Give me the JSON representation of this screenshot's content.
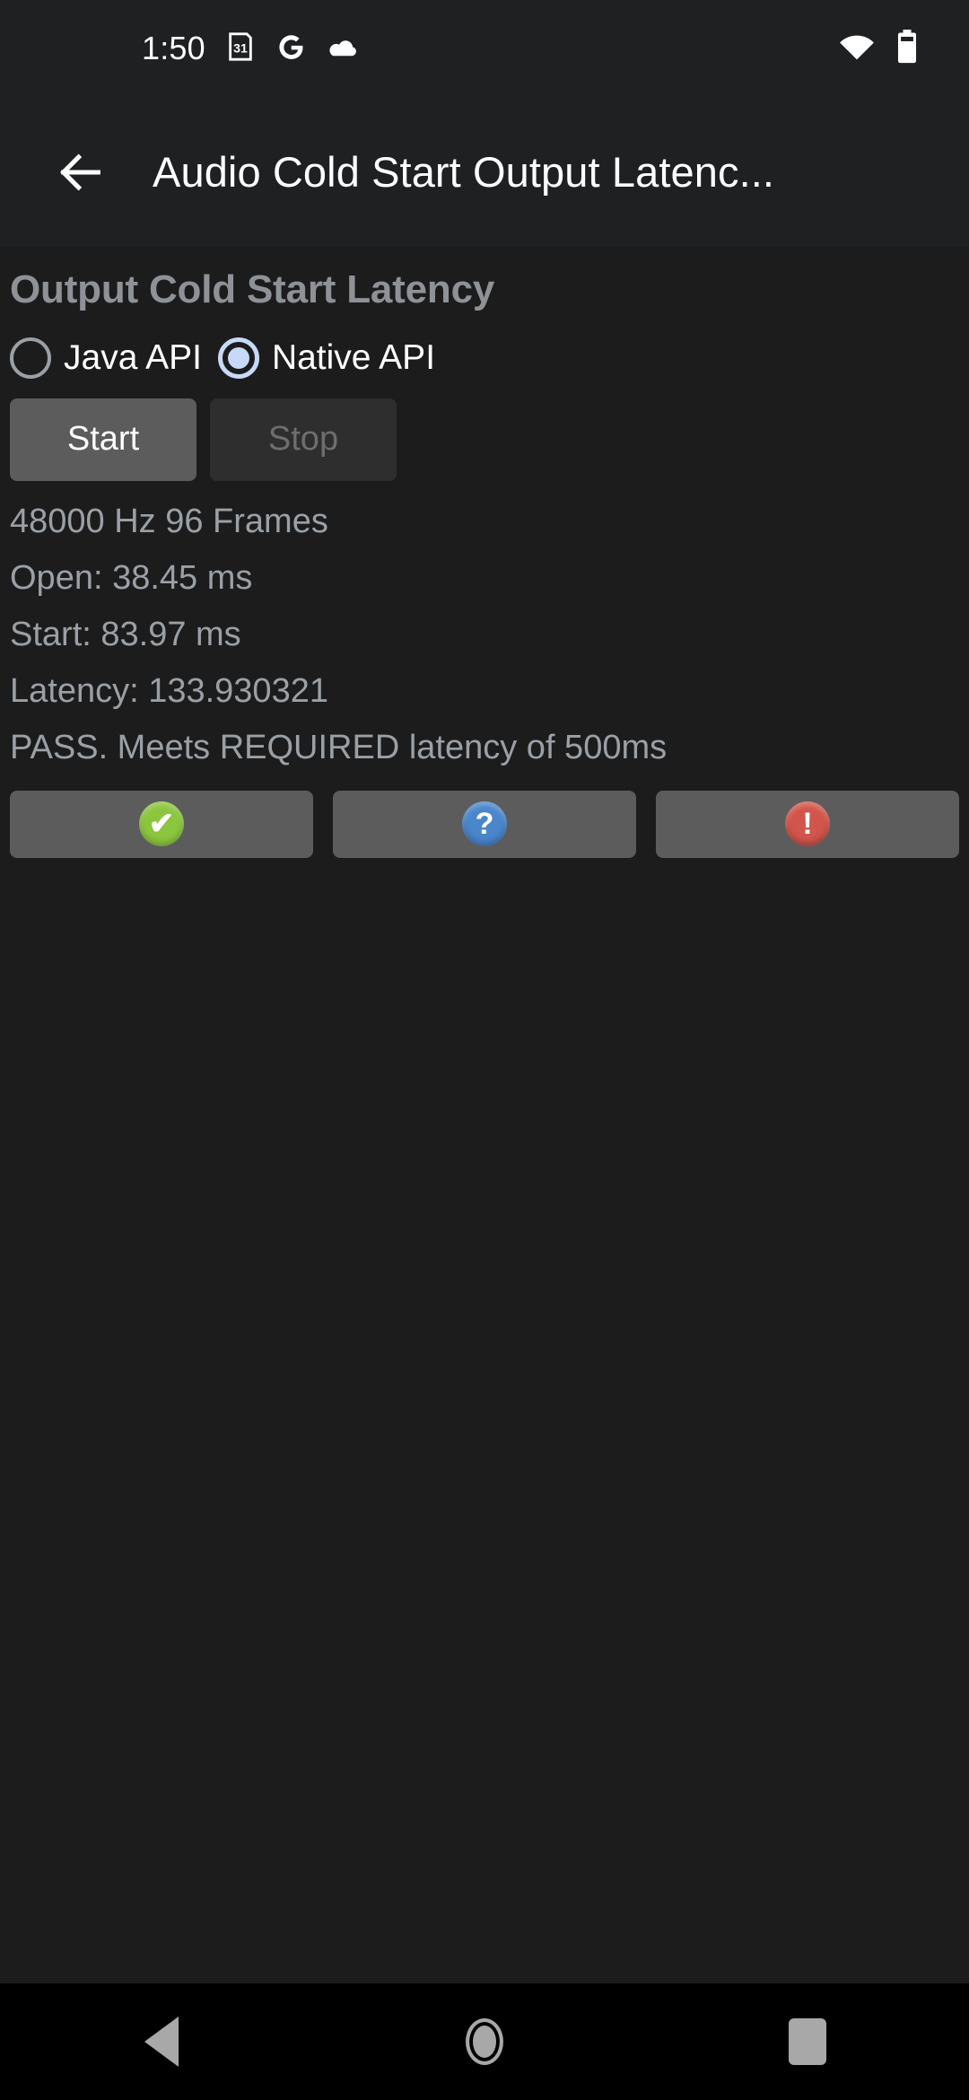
{
  "status_bar": {
    "time": "1:50",
    "left_icons": [
      "calendar-31-icon",
      "google-g-icon",
      "cloud-icon"
    ],
    "right_icons": [
      "wifi-icon",
      "battery-icon"
    ],
    "calendar_day": "31",
    "google_letter": "G"
  },
  "app_bar": {
    "back_label": "back-arrow-icon",
    "title": "Audio Cold Start Output Latenc..."
  },
  "main": {
    "heading": "Output Cold Start Latency",
    "api_options": [
      {
        "label": "Java API",
        "selected": false
      },
      {
        "label": "Native API",
        "selected": true
      }
    ],
    "buttons": {
      "start_label": "Start",
      "start_enabled": true,
      "stop_label": "Stop",
      "stop_enabled": false
    },
    "results": [
      "48000 Hz 96 Frames",
      "Open: 38.45 ms",
      "Start: 83.97 ms",
      "Latency: 133.930321",
      "PASS. Meets REQUIRED latency of 500ms"
    ],
    "verdict_buttons": [
      {
        "icon": "pass-check-icon",
        "glyph": "✔",
        "color": "#8cc63f"
      },
      {
        "icon": "info-question-icon",
        "glyph": "?",
        "color": "#4a86cc"
      },
      {
        "icon": "fail-exclamation-icon",
        "glyph": "!",
        "color": "#d1554c"
      }
    ]
  },
  "nav_bar": {
    "back": "nav-back-icon",
    "home": "nav-home-icon",
    "recents": "nav-recents-icon"
  },
  "colors": {
    "background": "#1c1c1c",
    "app_bar": "#1e2022",
    "accent_radio": "#c7d9f7",
    "text_primary": "#ffffff",
    "text_secondary": "#9aa0a6",
    "button_enabled": "#5c5c5c",
    "button_disabled": "#2e2e2e",
    "nav_bar": "#000000"
  }
}
